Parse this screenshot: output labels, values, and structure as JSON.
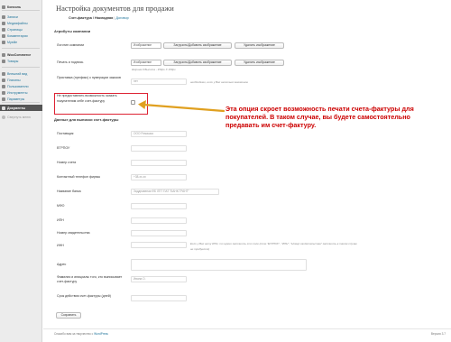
{
  "sidebar": {
    "items": [
      {
        "label": "Консоль",
        "bold": true
      },
      {
        "label": "Записи"
      },
      {
        "label": "Медиафайлы"
      },
      {
        "label": "Страницы"
      },
      {
        "label": "Комментарии"
      },
      {
        "label": "Mystile"
      },
      {
        "label": "WooCommerce",
        "bold": true
      },
      {
        "label": "Товары"
      },
      {
        "label": "Внешний вид"
      },
      {
        "label": "Плагины"
      },
      {
        "label": "Пользователи"
      },
      {
        "label": "Инструменты"
      },
      {
        "label": "Параметры"
      },
      {
        "label": "Документы",
        "current": true
      },
      {
        "label": "Свернуть меню",
        "collapse": true
      }
    ]
  },
  "page": {
    "title": "Настройка документов для продажи",
    "subsub_current": "Счет-фактура / Накладная",
    "subsub_sep": "|",
    "subsub_link": "Договор"
  },
  "company": {
    "section_title": "Атрибуты компании",
    "logo_label": "Логотип компании",
    "stamp_label": "Печать и подпись",
    "stamp_hint": "Ширина 0 Высота - 150px X 150px",
    "prefix_label": "Приставка (префикс) к нумерации заказов",
    "prefix_value": "нет",
    "prefix_hint": "необходимо, если у Вас несколько магазинов",
    "image_value": "Изображение",
    "upload_button": "Загрузить/Добавить изображение",
    "delete_button": "Удалить изображение",
    "hide_print_label": "Не предоставлять возможность оказать покупателям себе счет-фактуру"
  },
  "invoice": {
    "section_title": "Данные для выписки счет-фактуры",
    "fields": [
      {
        "label": "Поставщик",
        "placeholder": "ООО Ромашка"
      },
      {
        "label": "ЕГРПОУ",
        "placeholder": ""
      },
      {
        "label": "Номер счета",
        "placeholder": ""
      },
      {
        "label": "Контактный телефон фирмы",
        "placeholder": "+38-xx-xx"
      },
      {
        "label": "Название банка",
        "placeholder": "Заддеавеная ФБ ЛПТ ПАТ \"БАНК ГРАНТ\""
      },
      {
        "label": "МФО",
        "placeholder": ""
      },
      {
        "label": "ИПН",
        "placeholder": ""
      },
      {
        "label": "Номер свидетельства",
        "placeholder": ""
      },
      {
        "label": "ИНН",
        "placeholder": ""
      },
      {
        "label": "Адрес",
        "placeholder": ""
      },
      {
        "label": "Фамилия и инициалы того, кто выписывает счет-фактуру",
        "placeholder": "Ивана О."
      },
      {
        "label": "Срок действия счет-фактуры (дней)",
        "placeholder": ""
      }
    ],
    "inn_hint_1": "Если у Вас нету ИПН, то нужно заполнить это поле (поле \"ЕГРПОУ\", \"ИПН\", \"Номер свидетельства\" заполнить в таком случае",
    "inn_hint_2": "не требуется)",
    "save_button": "Сохранить"
  },
  "annotation": {
    "text": "Эта опция скроет возможность печати счета-фактуры для покупателей. В таком случае, вы будете самостоятельно предавать им счет-фактуру.",
    "color": "#c00000"
  },
  "footer": {
    "text_before": "Спасибо вам за творчество с ",
    "link": "WordPress",
    "version": "Версия 3.7"
  },
  "colors": {
    "link": "#21759b",
    "highlight": "#dd2233",
    "arrow": "#e0a020"
  }
}
